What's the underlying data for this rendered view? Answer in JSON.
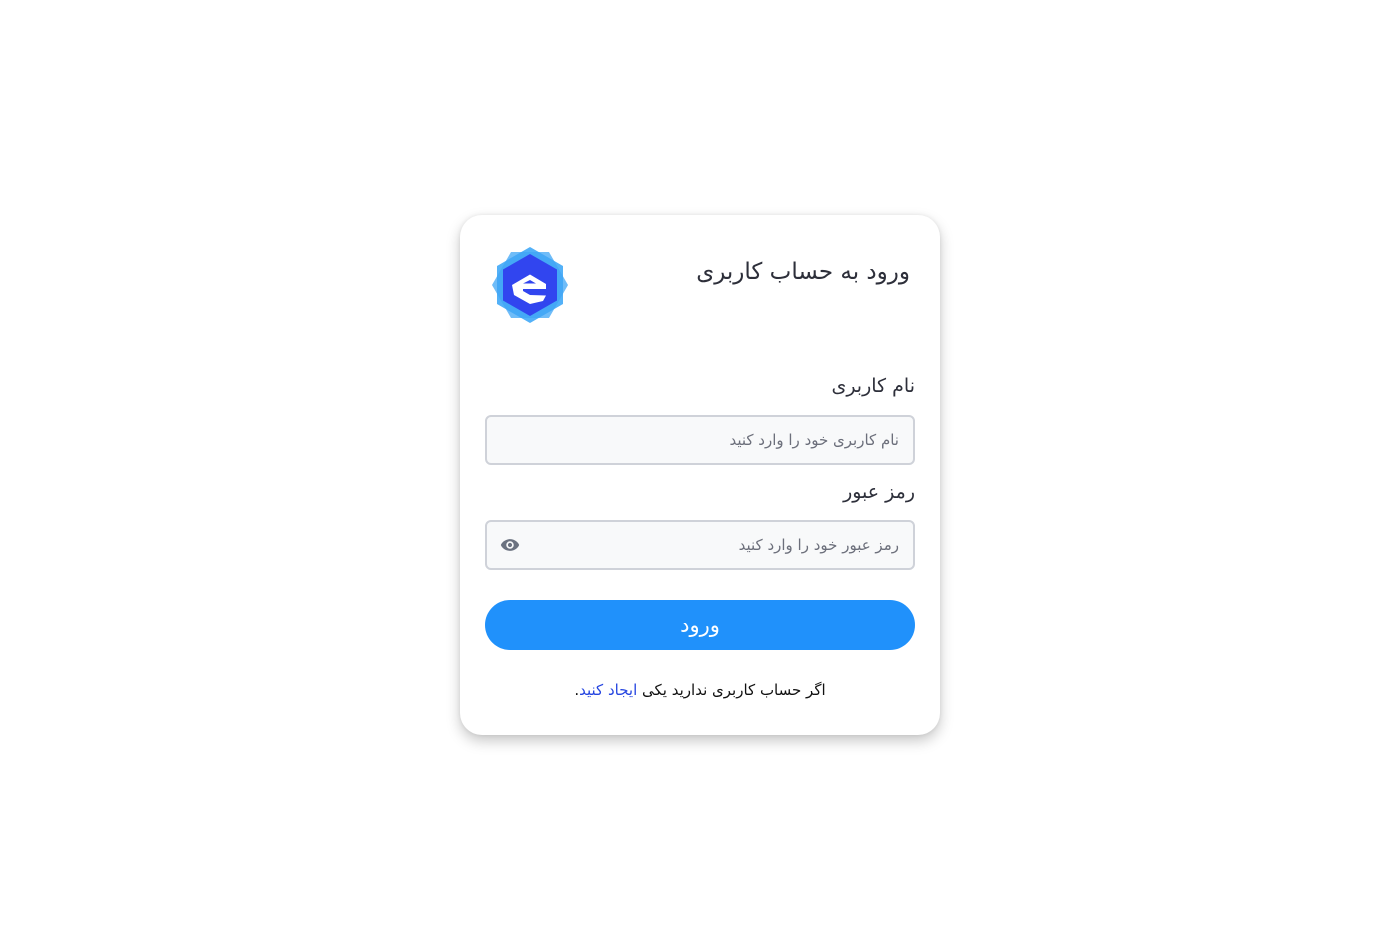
{
  "header": {
    "title": "ورود به حساب کاربری",
    "logo_icon": "hexagon-e-logo"
  },
  "form": {
    "username_label": "نام کاربری",
    "username_placeholder": "نام کاربری خود را وارد کنید",
    "username_value": "",
    "password_label": "رمز عبور",
    "password_placeholder": "رمز عبور خود را وارد کنید",
    "password_value": "",
    "password_toggle_icon": "eye-icon",
    "submit_label": "ورود"
  },
  "footer": {
    "prefix": "اگر حساب کاربری ندارید یکی ",
    "link_text": "ایجاد کنید",
    "suffix": "."
  },
  "colors": {
    "primary_button": "#2091fb",
    "link": "#2545e0",
    "logo_dark": "#3044f0",
    "logo_light": "#3fa6f6"
  }
}
